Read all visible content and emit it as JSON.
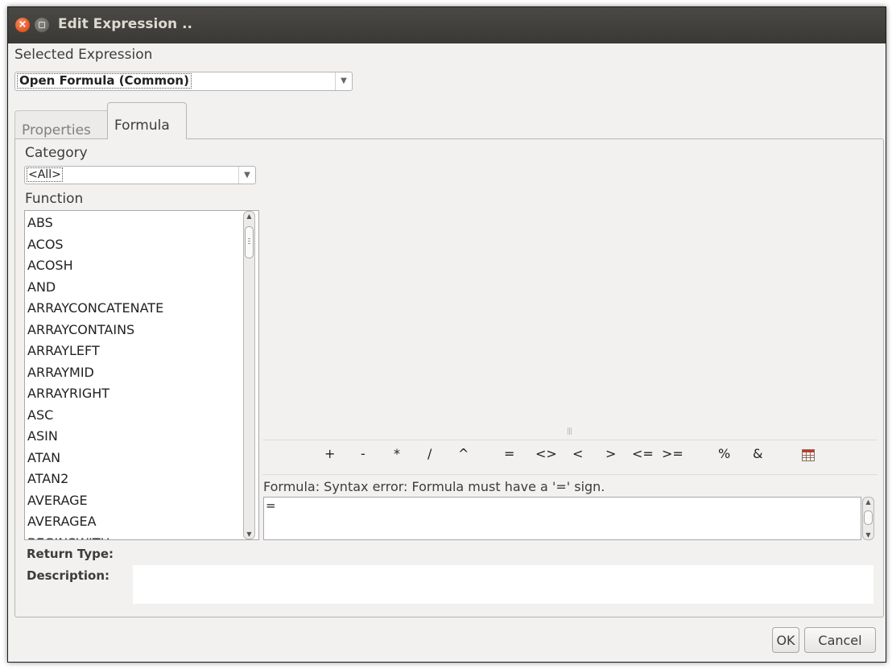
{
  "window": {
    "title": "Edit Expression .."
  },
  "selected_expression": {
    "label": "Selected Expression",
    "value": "Open Formula (Common)"
  },
  "tabs": [
    {
      "label": "Properties",
      "active": false
    },
    {
      "label": "Formula",
      "active": true
    }
  ],
  "category": {
    "label": "Category",
    "value": "<All>"
  },
  "function": {
    "label": "Function",
    "items": [
      "ABS",
      "ACOS",
      "ACOSH",
      "AND",
      "ARRAYCONCATENATE",
      "ARRAYCONTAINS",
      "ARRAYLEFT",
      "ARRAYMID",
      "ARRAYRIGHT",
      "ASC",
      "ASIN",
      "ATAN",
      "ATAN2",
      "AVERAGE",
      "AVERAGEA",
      "BEGINSWITH"
    ]
  },
  "operators": [
    "+",
    "-",
    "*",
    "/",
    "^",
    "=",
    "<>",
    "<",
    ">",
    "<=",
    ">=",
    "%",
    "&"
  ],
  "formula": {
    "status": "Formula: Syntax error: Formula must have a '=' sign.",
    "value": "="
  },
  "return_type_label": "Return Type:",
  "description_label": "Description:",
  "buttons": {
    "ok": "OK",
    "cancel": "Cancel"
  },
  "icons": {
    "close": "close-icon",
    "minimize": "minimize-icon",
    "table": "table-icon"
  },
  "colors": {
    "titlebar": "#3c3b37",
    "close": "#e4531f",
    "background": "#f2f1f0"
  }
}
